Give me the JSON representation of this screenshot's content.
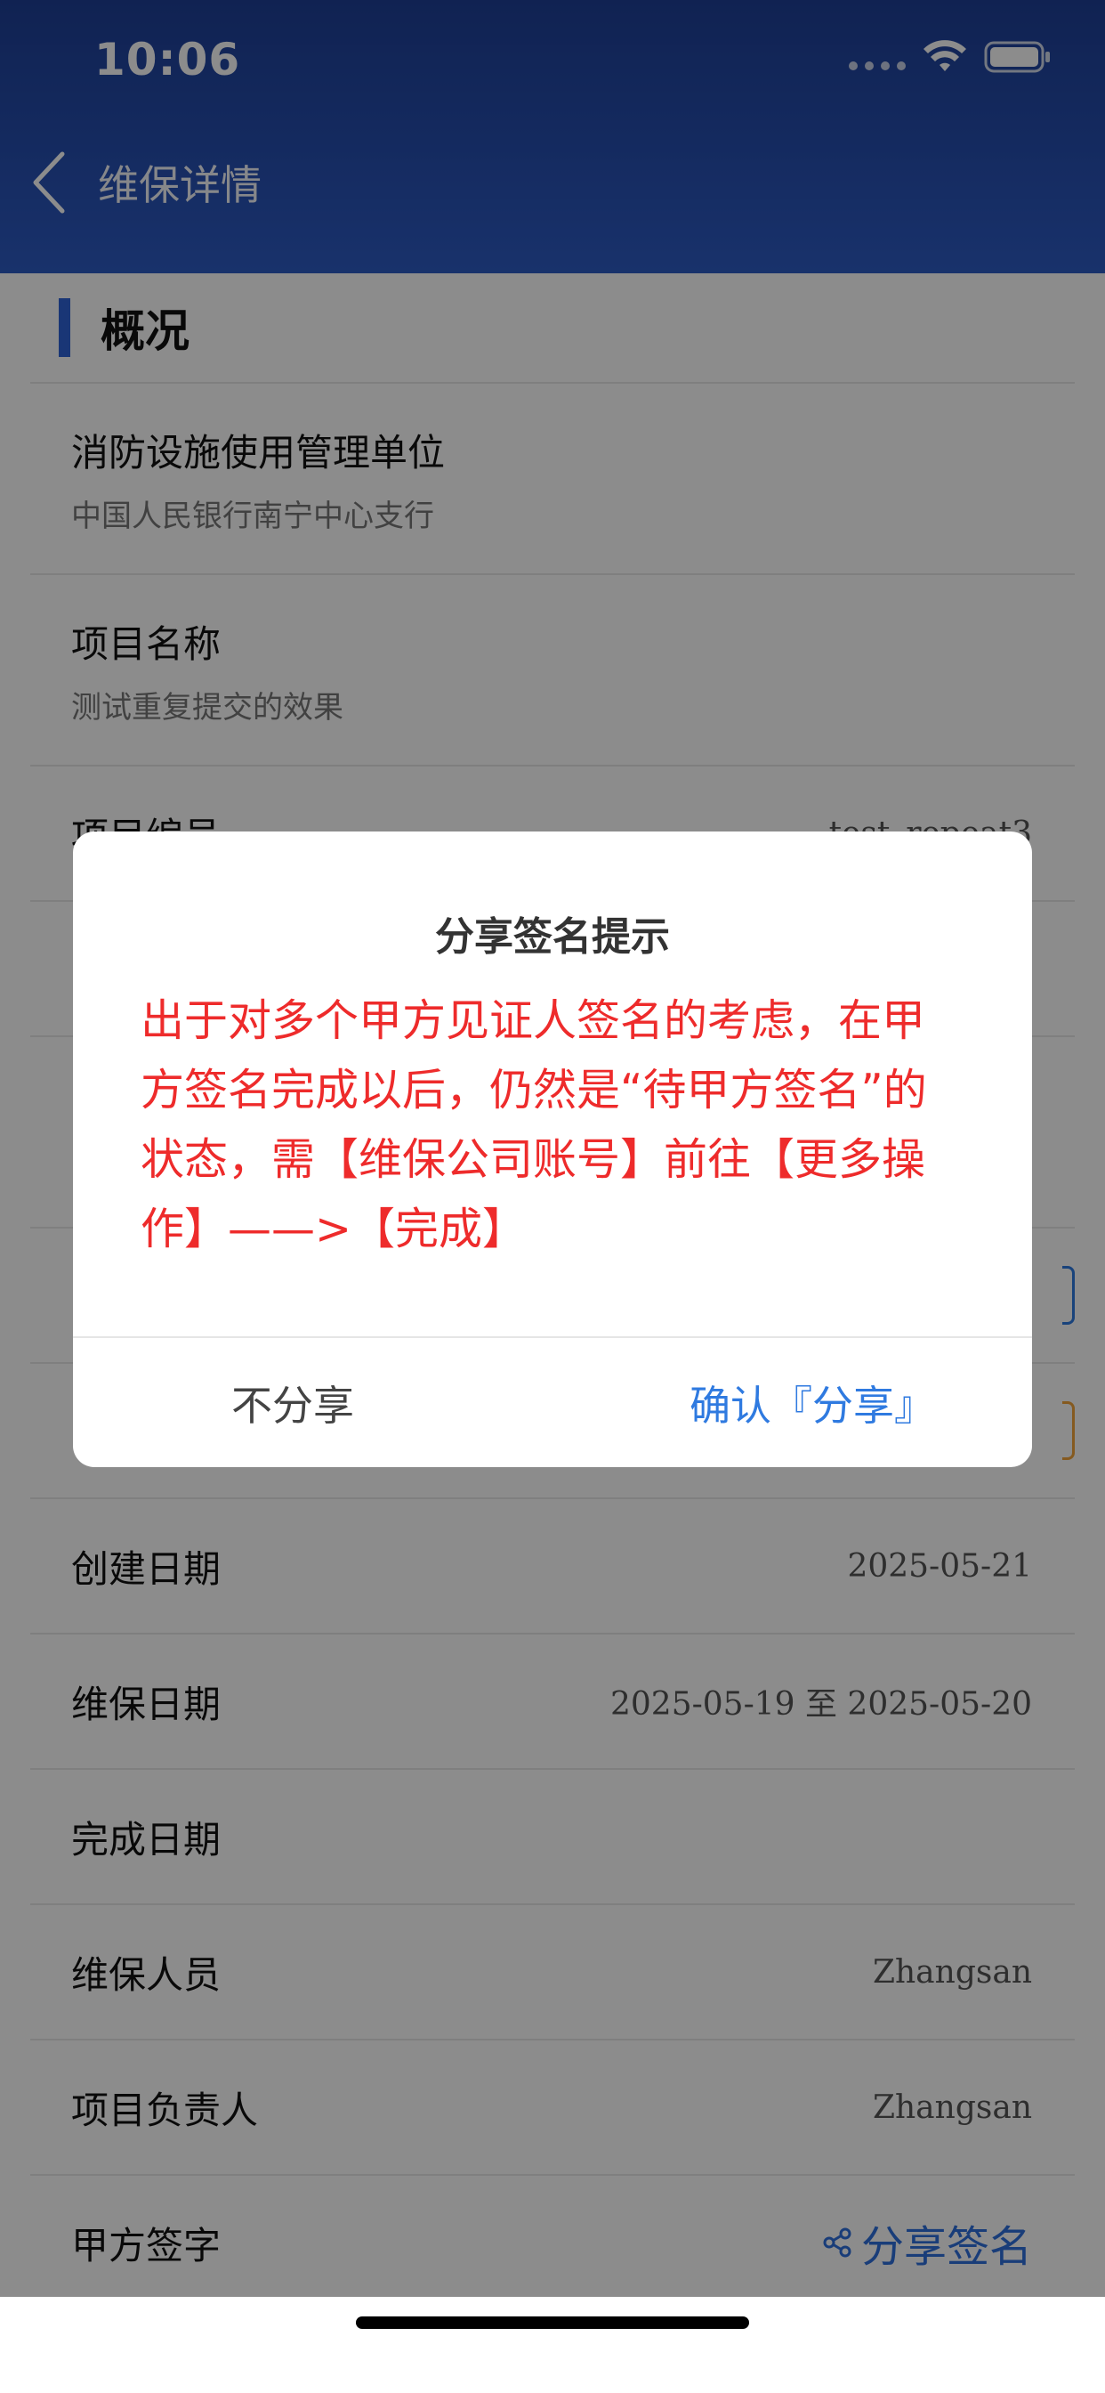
{
  "status_bar": {
    "time": "10:06"
  },
  "nav": {
    "title": "维保详情"
  },
  "section": {
    "title": "概况"
  },
  "rows": [
    {
      "label": "消防设施使用管理单位",
      "sub": "中国人民银行南宁中心支行"
    },
    {
      "label": "项目名称",
      "sub": "测试重复提交的效果"
    },
    {
      "label": "项目编号",
      "value": "test_repeat3"
    }
  ],
  "detail_rows": [
    {
      "label": "创建日期",
      "value": "2025-05-21"
    },
    {
      "label": "维保日期",
      "value": "2025-05-19 至 2025-05-20"
    },
    {
      "label": "完成日期",
      "value": ""
    },
    {
      "label": "维保人员",
      "value": "Zhangsan"
    },
    {
      "label": "项目负责人",
      "value": "Zhangsan"
    },
    {
      "label": "甲方签字",
      "action": "分享签名"
    }
  ],
  "dialog": {
    "title": "分享签名提示",
    "message": "出于对多个甲方见证人签名的考虑，在甲方签名完成以后，仍然是“待甲方签名”的状态，需【维保公司账号】前往【更多操作】——>【完成】",
    "cancel_label": "不分享",
    "confirm_label": "确认『分享』"
  },
  "colors": {
    "header": "#2d5bc4",
    "accent": "#2f63d8",
    "warning_text": "#ee2b2b",
    "link": "#2f7ae0"
  },
  "icons": {
    "back": "chevron-left-icon",
    "wifi": "wifi-icon",
    "battery": "battery-icon",
    "share": "share-icon"
  }
}
